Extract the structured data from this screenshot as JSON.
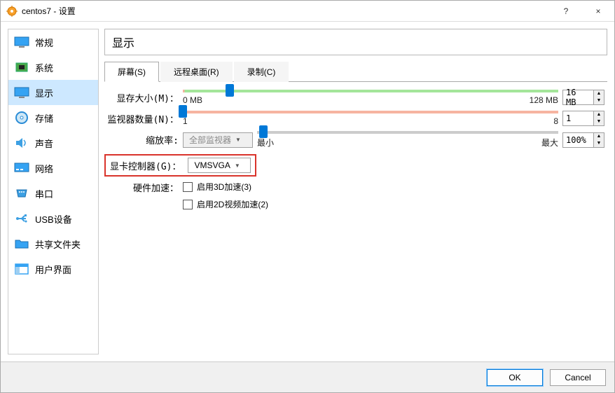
{
  "window": {
    "title": "centos7 - 设置",
    "help": "?",
    "close": "×"
  },
  "sidebar": {
    "items": [
      {
        "label": "常规"
      },
      {
        "label": "系统"
      },
      {
        "label": "显示"
      },
      {
        "label": "存储"
      },
      {
        "label": "声音"
      },
      {
        "label": "网络"
      },
      {
        "label": "串口"
      },
      {
        "label": "USB设备"
      },
      {
        "label": "共享文件夹"
      },
      {
        "label": "用户界面"
      }
    ]
  },
  "panel": {
    "title": "显示",
    "tabs": [
      {
        "label": "屏幕(S)"
      },
      {
        "label": "远程桌面(R)"
      },
      {
        "label": "录制(C)"
      }
    ]
  },
  "form": {
    "vmem_label": "显存大小(M)：",
    "vmem_min": "0 MB",
    "vmem_max": "128 MB",
    "vmem_value": "16 MB",
    "monitors_label": "监视器数量(N)：",
    "monitors_min": "1",
    "monitors_max": "8",
    "monitors_value": "1",
    "zoom_label": "缩放率:",
    "zoom_target": "全部监视器",
    "zoom_min": "最小",
    "zoom_max": "最大",
    "zoom_value": "100%",
    "controller_label": "显卡控制器(G)：",
    "controller_value": "VMSVGA",
    "accel_label": "硬件加速：",
    "accel_3d": "启用3D加速(3)",
    "accel_2d": "启用2D视频加速(2)"
  },
  "footer": {
    "ok": "OK",
    "cancel": "Cancel"
  }
}
